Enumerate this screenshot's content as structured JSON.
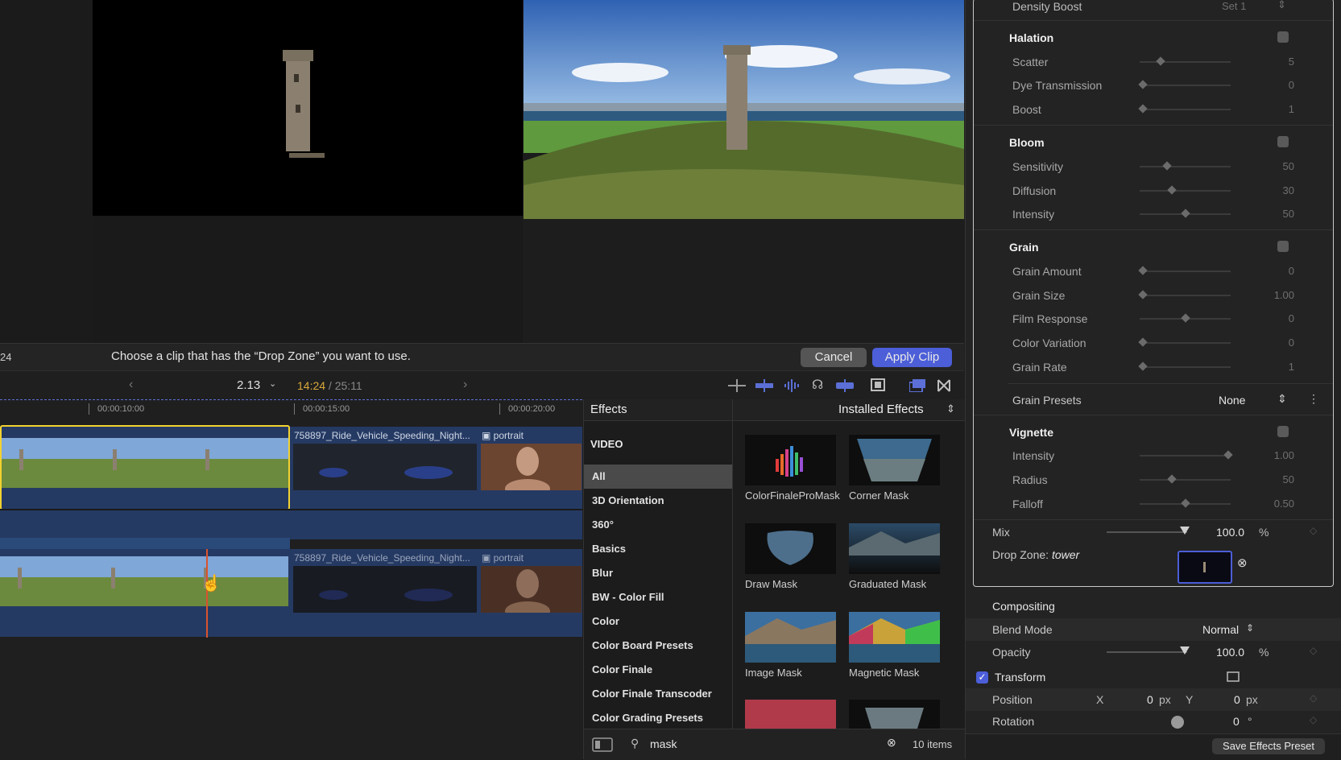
{
  "viewer": {
    "frame_label": "24",
    "prompt_text": "Choose a clip that has the “Drop Zone” you want to use.",
    "cancel_label": "Cancel",
    "apply_label": "Apply Clip"
  },
  "timeline_toolbar": {
    "zoom_value": "2.13",
    "timecode_current": "14:24",
    "timecode_separator": " / ",
    "timecode_total": "25:11"
  },
  "timeline": {
    "ruler_ticks": [
      "00:00:10:00",
      "00:00:15:00",
      "00:00:20:00"
    ],
    "clip_labels": {
      "vehicle_top": "758897_Ride_Vehicle_Speeding_Night...",
      "portrait_top": "portrait",
      "vehicle_bottom": "758897_Ride_Vehicle_Speeding_Night...",
      "portrait_bottom": "portrait"
    }
  },
  "effects": {
    "title": "Effects",
    "source": "Installed Effects",
    "section_header": "VIDEO",
    "categories": [
      "All",
      "3D Orientation",
      "360°",
      "Basics",
      "Blur",
      "BW - Color Fill",
      "Color",
      "Color Board Presets",
      "Color Finale",
      "Color Finale Transcoder",
      "Color Grading Presets"
    ],
    "selected_category": "All",
    "items": [
      "ColorFinaleProMask",
      "Corner Mask",
      "Draw Mask",
      "Graduated Mask",
      "Image Mask",
      "Magnetic Mask"
    ],
    "search_value": "mask",
    "count": "10 items"
  },
  "inspector": {
    "density_boost": {
      "label": "Density Boost",
      "value": "Set 1"
    },
    "halation": {
      "title": "Halation",
      "rows": [
        {
          "label": "Scatter",
          "value": "5",
          "pos": 0.2
        },
        {
          "label": "Dye Transmission",
          "value": "0",
          "pos": 0.0
        },
        {
          "label": "Boost",
          "value": "1",
          "pos": 0.0
        }
      ]
    },
    "bloom": {
      "title": "Bloom",
      "rows": [
        {
          "label": "Sensitivity",
          "value": "50",
          "pos": 0.3
        },
        {
          "label": "Diffusion",
          "value": "30",
          "pos": 0.35
        },
        {
          "label": "Intensity",
          "value": "50",
          "pos": 0.5
        }
      ]
    },
    "grain": {
      "title": "Grain",
      "rows": [
        {
          "label": "Grain Amount",
          "value": "0",
          "pos": 0.0
        },
        {
          "label": "Grain Size",
          "value": "1.00",
          "pos": 0.0
        },
        {
          "label": "Film Response",
          "value": "0",
          "pos": 0.5
        },
        {
          "label": "Color Variation",
          "value": "0",
          "pos": 0.0
        },
        {
          "label": "Grain Rate",
          "value": "1",
          "pos": 0.0
        }
      ]
    },
    "grain_presets": {
      "label": "Grain Presets",
      "value": "None"
    },
    "vignette": {
      "title": "Vignette",
      "rows": [
        {
          "label": "Intensity",
          "value": "1.00",
          "pos": 0.95
        },
        {
          "label": "Radius",
          "value": "50",
          "pos": 0.33
        },
        {
          "label": "Falloff",
          "value": "0.50",
          "pos": 0.5
        }
      ]
    },
    "mix": {
      "label": "Mix",
      "value": "100.0",
      "unit": "%",
      "pos": 1.0
    },
    "drop_zone": {
      "prefix": "Drop Zone:",
      "name": "tower"
    },
    "compositing": {
      "title": "Compositing",
      "blend_label": "Blend Mode",
      "blend_value": "Normal",
      "opacity_label": "Opacity",
      "opacity_value": "100.0",
      "opacity_unit": "%",
      "opacity_pos": 1.0
    },
    "transform": {
      "title": "Transform",
      "position_label": "Position",
      "x_label": "X",
      "x_value": "0",
      "x_unit": "px",
      "y_label": "Y",
      "y_value": "0",
      "y_unit": "px",
      "rotation_label": "Rotation",
      "rotation_value": "0",
      "rotation_unit": "°"
    },
    "save_preset_label": "Save Effects Preset"
  },
  "colors": {
    "accent": "#4c5ed8",
    "selection": "#f2d230",
    "clip_blue": "#253a63",
    "playhead": "#d9532e"
  }
}
